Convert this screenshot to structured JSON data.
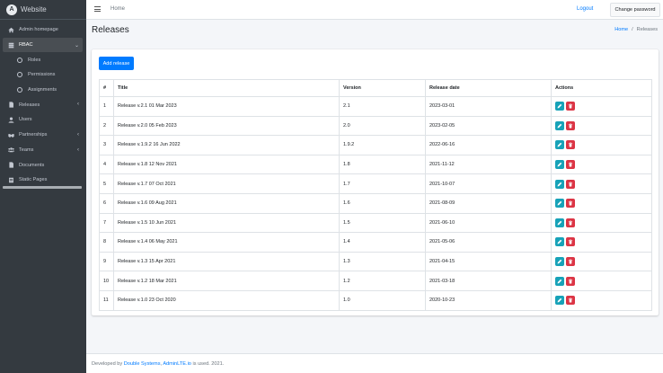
{
  "brand": {
    "name": "Website",
    "logo_letter": "A"
  },
  "sidebar": {
    "items": [
      {
        "label": "Admin homepage",
        "icon": "home-icon"
      },
      {
        "label": "RBAC",
        "icon": "server-icon",
        "arrow": "⌄"
      },
      {
        "label": "Roles",
        "icon": "circle-icon"
      },
      {
        "label": "Permissions",
        "icon": "circle-icon"
      },
      {
        "label": "Assignments",
        "icon": "circle-icon"
      },
      {
        "label": "Releases",
        "icon": "file-icon",
        "arrow": "‹"
      },
      {
        "label": "Users",
        "icon": "user-icon"
      },
      {
        "label": "Partnerships",
        "icon": "handshake-icon",
        "arrow": "‹"
      },
      {
        "label": "Teams",
        "icon": "users-icon",
        "arrow": "‹"
      },
      {
        "label": "Documents",
        "icon": "document-icon"
      },
      {
        "label": "Static Pages",
        "icon": "page-icon"
      }
    ]
  },
  "topbar": {
    "home": "Home",
    "logout": "Logout",
    "change_password": "Change password"
  },
  "page": {
    "title": "Releases",
    "breadcrumb": {
      "home": "Home",
      "separator": "/",
      "current": "Releases"
    },
    "add_button": "Add release"
  },
  "table": {
    "headers": [
      "#",
      "Title",
      "Version",
      "Release date",
      "Actions"
    ],
    "rows": [
      [
        "1",
        "Release v.2.1 01 Mar 2023",
        "2.1",
        "2023-03-01"
      ],
      [
        "2",
        "Release v.2.0 05 Feb 2023",
        "2.0",
        "2023-02-05"
      ],
      [
        "3",
        "Release v.1.9.2 16 Jun 2022",
        "1.9.2",
        "2022-06-16"
      ],
      [
        "4",
        "Release v.1.8 12 Nov 2021",
        "1.8",
        "2021-11-12"
      ],
      [
        "5",
        "Release v.1.7 07 Oct 2021",
        "1.7",
        "2021-10-07"
      ],
      [
        "6",
        "Release v.1.6 09 Aug 2021",
        "1.6",
        "2021-08-09"
      ],
      [
        "7",
        "Release v.1.5 10 Jun 2021",
        "1.5",
        "2021-06-10"
      ],
      [
        "8",
        "Release v.1.4 06 May 2021",
        "1.4",
        "2021-05-06"
      ],
      [
        "9",
        "Release v.1.3 15 Apr 2021",
        "1.3",
        "2021-04-15"
      ],
      [
        "10",
        "Release v.1.2 18 Mar 2021",
        "1.2",
        "2021-03-18"
      ],
      [
        "11",
        "Release v.1.0 23 Oct 2020",
        "1.0",
        "2020-10-23"
      ]
    ]
  },
  "footer": {
    "prefix": "Developed by ",
    "link1": "Double Systems",
    "middle": ", ",
    "link2": "AdminLTE.io",
    "suffix": " is used. 2021."
  },
  "colors": {
    "primary": "#007bff",
    "edit": "#17a2b8",
    "delete": "#dc3545",
    "sidebar": "#343a40"
  }
}
